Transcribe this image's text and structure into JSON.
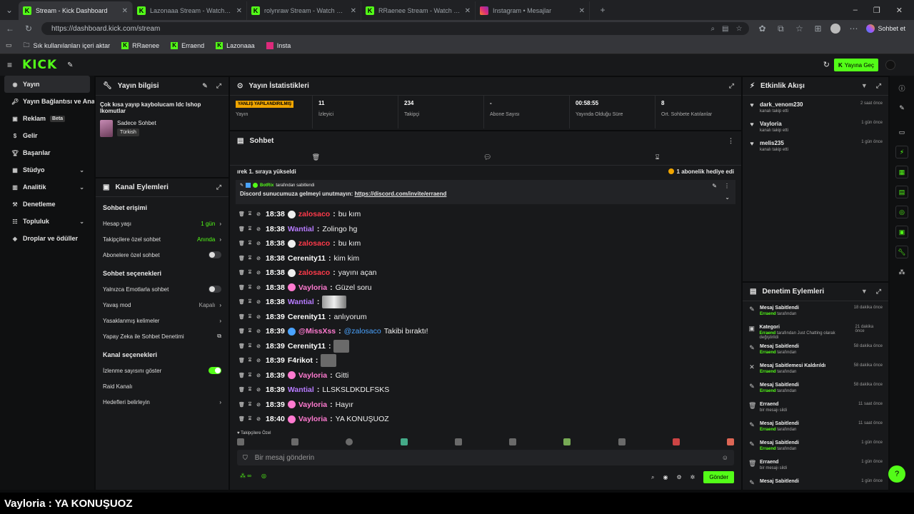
{
  "browser": {
    "tabs": [
      {
        "title": "Stream - Kick Dashboard",
        "icon": "kick-icon",
        "active": true
      },
      {
        "title": "Lazonaaa Stream - Watch Live on",
        "icon": "kick-icon"
      },
      {
        "title": "rolynraw Stream - Watch Live on",
        "icon": "kick-icon"
      },
      {
        "title": "RRaenee Stream - Watch Live on",
        "icon": "kick-icon"
      },
      {
        "title": "Instagram • Mesajlar",
        "icon": "instagram-icon"
      }
    ],
    "url": "https://dashboard.kick.com/stream",
    "chat_button": "Sohbet et",
    "bookmarks": [
      "Sık kullanılanları içeri aktar",
      "RRaenee",
      "Erraend",
      "Lazonaaa",
      "Insta"
    ]
  },
  "kick": {
    "logo": "KICK",
    "go_live": "Yayına Geç"
  },
  "sidebar": {
    "items": [
      {
        "label": "Yayın",
        "icon": "broadcast-icon"
      },
      {
        "label": "Yayın Bağlantısı ve Anahtar",
        "icon": "key-icon"
      },
      {
        "label": "Reklam",
        "badge": "Beta",
        "icon": "ad-icon"
      },
      {
        "label": "Gelir",
        "icon": "revenue-icon"
      },
      {
        "label": "Başarılar",
        "icon": "trophy-icon"
      },
      {
        "label": "Stüdyo",
        "icon": "studio-icon",
        "chevron": true
      },
      {
        "label": "Analitik",
        "icon": "analytics-icon",
        "chevron": true
      },
      {
        "label": "Denetleme",
        "icon": "moderation-icon"
      },
      {
        "label": "Topluluk",
        "icon": "community-icon",
        "chevron": true
      },
      {
        "label": "Droplar ve ödüller",
        "icon": "drops-icon"
      }
    ]
  },
  "stream_info": {
    "title": "Yayın bilgisi",
    "stream_title": "Çok kısa yayıp kaybolucam ldc lshop lkomutlar",
    "category": "Sadece Sohbet",
    "language": "Türkish"
  },
  "channel_actions": {
    "title": "Kanal Eylemleri",
    "chat_access": "Sohbet erişimi",
    "account_age": "Hesap yaşı",
    "account_age_value": "1 gün",
    "follower_chat": "Takipçilere özel sohbet",
    "follower_chat_value": "Anında",
    "sub_chat": "Abonelere özel sohbet",
    "chat_options": "Sohbet seçenekleri",
    "emote_only": "Yalnızca Emotlarla sohbet",
    "slow_mode": "Yavaş mod",
    "slow_mode_value": "Kapalı",
    "banned_words": "Yasaklanmış kelimeler",
    "ai_moderation": "Yapay Zeka ile Sohbet Denetimi",
    "channel_options": "Kanal seçenekleri",
    "show_viewers": "İzlenme sayısını göster",
    "raid": "Raid Kanalı",
    "goals": "Hedefleri belirleyin"
  },
  "stats": {
    "title": "Yayın İstatistikleri",
    "warning": "YANLIŞ YAPILANDIRILMIŞ",
    "items": [
      {
        "value": "11",
        "label": "İzleyici"
      },
      {
        "value": "234",
        "label": "Takipçi"
      },
      {
        "value": "-",
        "label": "Abone Sayısı"
      },
      {
        "value": "00:58:55",
        "label": "Yayında Olduğu Süre"
      },
      {
        "value": "8",
        "label": "Ort. Sohbete Katılanlar"
      }
    ],
    "stream_label": "Yayın"
  },
  "chat": {
    "title": "Sohbet",
    "banner_left": "ırek 1. sıraya yükseldi",
    "banner_right": "1 abonelik hediye edi",
    "pinned_by": "BotRix",
    "pinned_suffix": "tarafından sabitlendi",
    "pinned_text": "Discord sunucumuza gelmeyi unutmayın: ",
    "pinned_link": "https://discord.com/invite/erraend",
    "messages": [
      {
        "time": "18:38",
        "user": "zalosaco",
        "color": "#ff3a4a",
        "badge": "#eeeeee",
        "text": "bu kım"
      },
      {
        "time": "18:38",
        "user": "Wantial",
        "color": "#b77bff",
        "badge": "",
        "text": "Zolingo hg"
      },
      {
        "time": "18:38",
        "user": "zalosaco",
        "color": "#ff3a4a",
        "badge": "#eeeeee",
        "text": "bu kım"
      },
      {
        "time": "18:38",
        "user": "Cerenity11",
        "color": "#ffffff",
        "badge": "",
        "text": "kim kim"
      },
      {
        "time": "18:38",
        "user": "zalosaco",
        "color": "#ff3a4a",
        "badge": "#eeeeee",
        "text": "yayını açan"
      },
      {
        "time": "18:38",
        "user": "Vayloria",
        "color": "#ff7ad0",
        "badge": "#ff7ad0",
        "text": "Güzel soru"
      },
      {
        "time": "18:38",
        "user": "Wantial",
        "color": "#b77bff",
        "badge": "",
        "text": "",
        "emote": "wide"
      },
      {
        "time": "18:39",
        "user": "Cerenity11",
        "color": "#ffffff",
        "badge": "",
        "text": "anlıyorum"
      },
      {
        "time": "18:39",
        "user": "@MissXss",
        "color": "#ff7ad0",
        "badge": "#4aa3ff",
        "text": "Takibi bıraktı!",
        "mention": "@zalosaco"
      },
      {
        "time": "18:39",
        "user": "Cerenity11",
        "color": "#ffffff",
        "badge": "",
        "text": "",
        "emote": "small"
      },
      {
        "time": "18:39",
        "user": "F4rikot",
        "color": "#ffffff",
        "badge": "",
        "text": "",
        "emote": "small"
      },
      {
        "time": "18:39",
        "user": "Vayloria",
        "color": "#ff7ad0",
        "badge": "#ff7ad0",
        "text": "Gitti"
      },
      {
        "time": "18:39",
        "user": "Wantial",
        "color": "#b77bff",
        "badge": "",
        "text": "LLSKSLDKDLFSKS"
      },
      {
        "time": "18:39",
        "user": "Vayloria",
        "color": "#ff7ad0",
        "badge": "#ff7ad0",
        "text": "Hayır"
      },
      {
        "time": "18:40",
        "user": "Vayloria",
        "color": "#ff7ad0",
        "badge": "#ff7ad0",
        "text": "YA KONUŞUOZ"
      }
    ],
    "follower_only": "Takipçilere Özel",
    "input_placeholder": "Bir mesaj gönderin",
    "send": "Gönder"
  },
  "activity": {
    "title": "Etkinlik Akışı",
    "items": [
      {
        "name": "dark_venom230",
        "sub": "kanalı takip etti",
        "time": "2 saat önce"
      },
      {
        "name": "Vayloria",
        "sub": "kanalı takip etti",
        "time": "1 gün önce"
      },
      {
        "name": "melis235",
        "sub": "kanalı takip etti",
        "time": "1 gün önce"
      }
    ]
  },
  "moderation": {
    "title": "Denetim Eylemleri",
    "items": [
      {
        "icon": "pin-icon",
        "name": "Mesaj Sabitlendi",
        "actor": "Erraend",
        "sub": " tarafından",
        "time": "18 dakika önce"
      },
      {
        "icon": "category-icon",
        "name": "Kategori",
        "actor": "Erraend",
        "sub": " tarafından Just Chatting olarak değiştirildi",
        "time": "21 dakika önce"
      },
      {
        "icon": "pin-icon",
        "name": "Mesaj Sabitlendi",
        "actor": "Erraend",
        "sub": " tarafından",
        "time": "58 dakika önce"
      },
      {
        "icon": "unpin-icon",
        "name": "Mesaj Sabitlemesi Kaldırıldı",
        "actor": "Erraend",
        "sub": " tarafından",
        "time": "58 dakika önce"
      },
      {
        "icon": "pin-icon",
        "name": "Mesaj Sabitlendi",
        "actor": "Erraend",
        "sub": " tarafından",
        "time": "58 dakika önce"
      },
      {
        "icon": "trash-icon",
        "name": "Erraend",
        "actor": "",
        "sub": "bir mesajı sildi",
        "time": "11 saat önce"
      },
      {
        "icon": "pin-icon",
        "name": "Mesaj Sabitlendi",
        "actor": "Erraend",
        "sub": " tarafından",
        "time": "11 saat önce"
      },
      {
        "icon": "pin-icon",
        "name": "Mesaj Sabitlendi",
        "actor": "Erraend",
        "sub": " tarafından",
        "time": "1 gün önce"
      },
      {
        "icon": "trash-icon",
        "name": "Erraend",
        "actor": "",
        "sub": "bir mesajı sildi",
        "time": "1 gün önce"
      },
      {
        "icon": "pin-icon",
        "name": "Mesaj Sabitlendi",
        "actor": "",
        "sub": "",
        "time": "1 gün önce"
      }
    ]
  },
  "caption": "Vayloria : YA KONUŞUOZ"
}
